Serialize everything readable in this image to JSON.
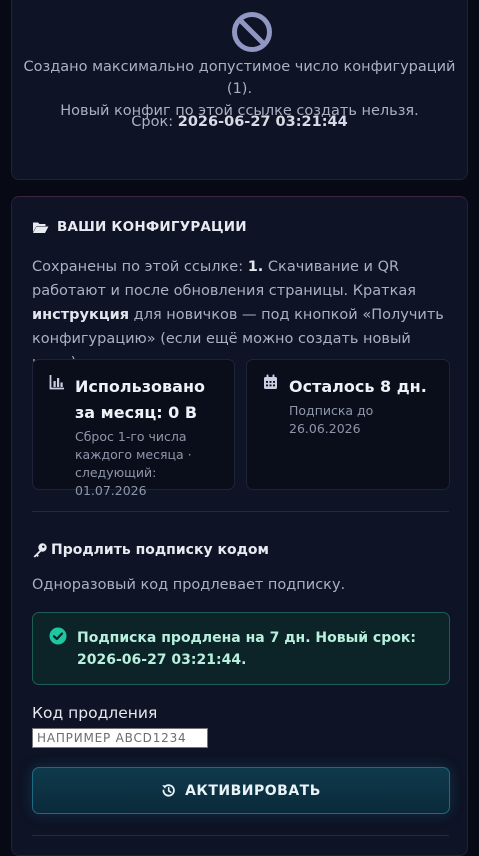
{
  "notice": {
    "icon": "no-entry-icon",
    "line1": "Создано максимально допустимое число конфигураций (1).",
    "line2": "Новый конфиг по этой ссылке создать нельзя.",
    "expiry_label": "Срок: ",
    "expiry_value": "2026-06-27 03:21:44"
  },
  "configs": {
    "icon": "folder-open-icon",
    "title": "ВАШИ КОНФИГУРАЦИИ",
    "desc_part1": "Сохранены по этой ссылке: ",
    "saved_count": "1.",
    "desc_part2": " Скачивание и QR работают и после обновления страницы. Краткая ",
    "desc_bold": "инструкция",
    "desc_part3": " для новичков — под кнопкой «Получить конфигурацию» (если ещё можно создать новый ключ).",
    "usage": {
      "icon": "bar-chart-icon",
      "title": "Использовано за месяц: 0 B",
      "note": "Сброс 1-го числа каждого месяца · следующий: 01.07.2026"
    },
    "remaining": {
      "icon": "calendar-icon",
      "title": "Осталось 8 дн.",
      "note": "Подписка до 26.06.2026"
    }
  },
  "extend": {
    "icon": "key-icon",
    "title": "Продлить подписку кодом",
    "desc": "Одноразовый код продлевает подписку.",
    "success_icon": "check-circle-icon",
    "success_message": "Подписка продлена на 7 дн. Новый срок: 2026-06-27 03:21:44.",
    "code_label": "Код продления",
    "code_value": "",
    "code_placeholder": "НАПРИМЕР ABCD1234",
    "button_icon": "history-icon",
    "button_label": "АКТИВИРОВАТЬ"
  },
  "colors": {
    "background": "#070a14",
    "card": "#0e1325",
    "accent": "#1e6a82",
    "success": "#1fc7a0",
    "icon_muted": "#8f97c2"
  }
}
